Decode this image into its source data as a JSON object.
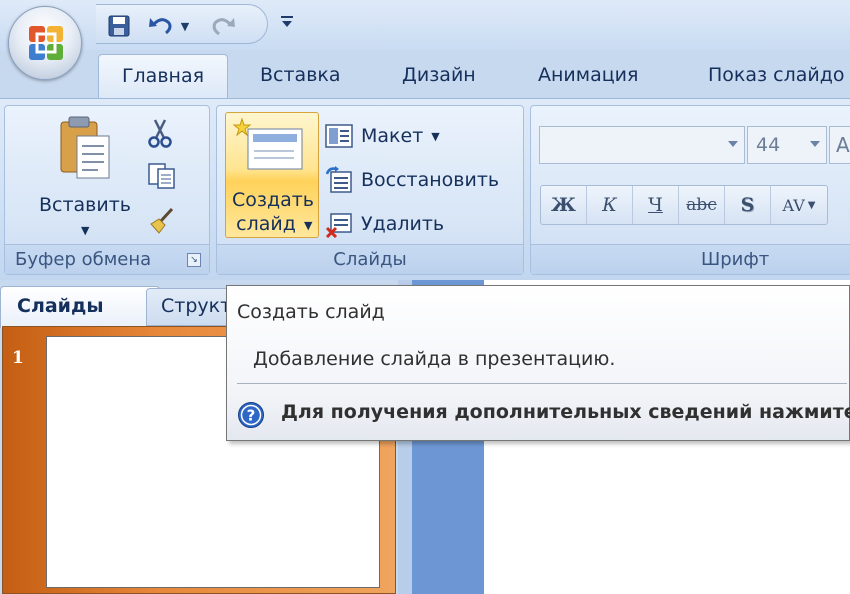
{
  "tabs": [
    "Главная",
    "Вставка",
    "Дизайн",
    "Анимация",
    "Показ слайдо"
  ],
  "clipboard": {
    "paste_label": "Вставить",
    "group_label": "Буфер обмена"
  },
  "slides_group": {
    "new_slide_line1": "Создать",
    "new_slide_line2": "слайд",
    "layout_label": "Макет",
    "reset_label": "Восстановить",
    "delete_label": "Удалить",
    "group_label": "Слайды"
  },
  "font_group": {
    "font_name": "",
    "font_size": "44",
    "bold": "Ж",
    "italic": "К",
    "underline": "Ч",
    "strike": "abc",
    "shadow": "S",
    "spacing": "AV",
    "group_label": "Шрифт"
  },
  "left_pane": {
    "tab_slides": "Слайды",
    "tab_outline": "Структ",
    "slide_number": "1"
  },
  "tooltip": {
    "title": "Создать слайд",
    "description": "Добавление слайда в презентацию.",
    "help": "Для получения дополнительных сведений нажмите"
  },
  "colors": {
    "ribbon_bg": "#dfeaf8",
    "slides_pane": "#e7883a",
    "tab_text": "#15305b"
  }
}
